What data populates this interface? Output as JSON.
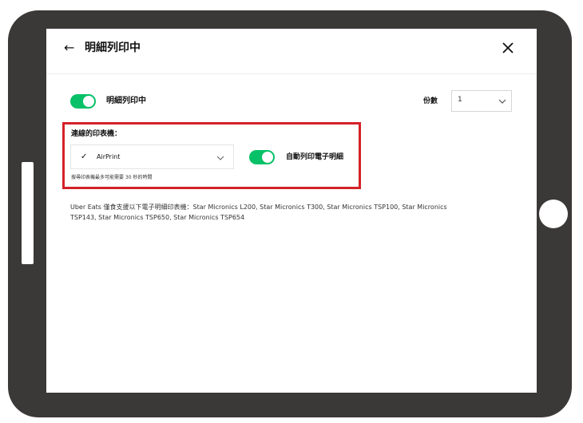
{
  "header": {
    "back_icon": "back-arrow-icon",
    "title": "明細列印中",
    "close_icon": "close-icon"
  },
  "receipt_printing": {
    "label": "明細列印中",
    "enabled": true
  },
  "copies": {
    "label": "份數",
    "value": "1"
  },
  "printer": {
    "label": "連線的印表機：",
    "selected_value": "AirPrint",
    "check_icon": "checkmark-icon",
    "hint": "搜尋印表機最多可能需要 30 秒的時間"
  },
  "auto_print": {
    "label": "自動列印電子明細",
    "enabled": true
  },
  "supported_text": "Uber Eats 僅食支援以下電子明細印表機：Star Micronics L200, Star Micronics T300, Star Micronics TSP100, Star Micronics TSP143, Star Micronics TSP650, Star Micronics TSP654",
  "colors": {
    "toggle_on": "#06c167",
    "highlight_border": "#d42128",
    "tablet_frame": "#3b3838"
  }
}
